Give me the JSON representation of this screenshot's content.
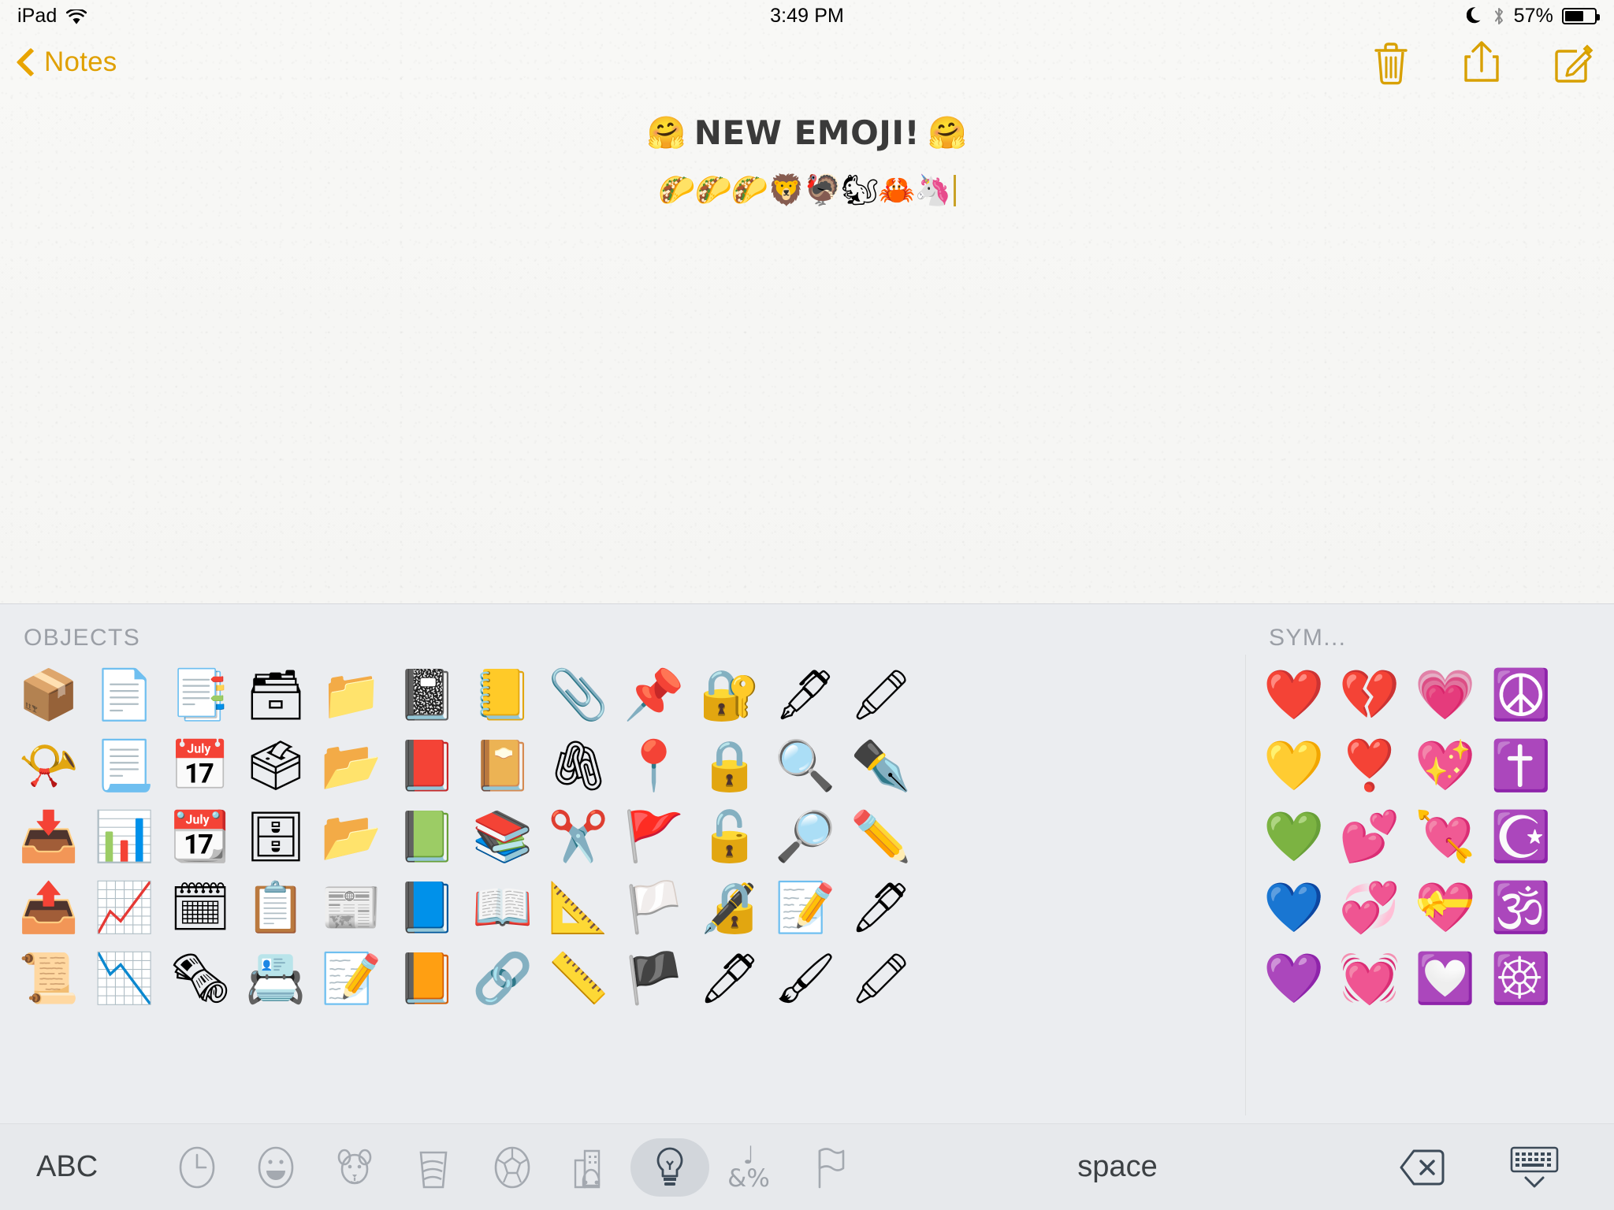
{
  "status_bar": {
    "device": "iPad",
    "wifi_icon": "wifi-icon",
    "time": "3:49 PM",
    "dnd_icon": "moon-icon",
    "bluetooth_icon": "bluetooth-icon",
    "battery_percent": "57%",
    "battery_level": 57
  },
  "nav_bar": {
    "back_label": "Notes",
    "back_icon": "chevron-left-icon",
    "accent_color": "#e0a000",
    "actions": [
      {
        "name": "trash-icon",
        "label": "Delete"
      },
      {
        "name": "share-icon",
        "label": "Share"
      },
      {
        "name": "compose-icon",
        "label": "New Note"
      }
    ]
  },
  "note": {
    "title_prefix_emoji": "🤗",
    "title_text": "NEW EMOJI!",
    "title_suffix_emoji": "🤗",
    "emoji_line": "🌮🌮🌮🦁🦃🐿🦀🦄",
    "text_color": "#3a3a3a",
    "paper_color": "#f7f7f5"
  },
  "keyboard": {
    "background": "#ebedf0",
    "sections": [
      {
        "id": "objects",
        "title": "OBJECTS",
        "emojis": [
          "📦",
          "📯",
          "📥",
          "📤",
          "📜",
          "📄",
          "📃",
          "📊",
          "📈",
          "📉",
          "📑",
          "📅",
          "📆",
          "🗓",
          "🗞",
          "🗃",
          "🗳",
          "🗄",
          "📋",
          "📇",
          "📁",
          "📂",
          "📂",
          "📰",
          "📝",
          "📓",
          "📕",
          "📗",
          "📘",
          "📙",
          "📒",
          "📔",
          "📚",
          "📖",
          "🔗",
          "📎",
          "🖇",
          "✂️",
          "📐",
          "📏",
          "📌",
          "📍",
          "🚩",
          "🏳️",
          "🏴",
          "🔐",
          "🔒",
          "🔓",
          "🔏",
          "🖊",
          "🖋",
          "🔍",
          "🔎",
          "📝",
          "🖌",
          "🖍",
          "✒️",
          "✏️",
          "🖊",
          "🖍"
        ]
      },
      {
        "id": "symbols",
        "title": "SYM...",
        "emojis": [
          "❤️",
          "💛",
          "💚",
          "💙",
          "💜",
          "💔",
          "❣️",
          "💕",
          "💞",
          "💓",
          "💗",
          "💖",
          "💘",
          "💝",
          "💟",
          "☮️",
          "✝️",
          "☪️",
          "🕉️",
          "☸️"
        ]
      }
    ],
    "bottom_bar": {
      "abc_label": "ABC",
      "space_label": "space",
      "categories": [
        {
          "name": "category-recent",
          "icon": "clock-icon",
          "active": false
        },
        {
          "name": "category-smileys",
          "icon": "smiley-icon",
          "active": false
        },
        {
          "name": "category-animals",
          "icon": "animal-icon",
          "active": false
        },
        {
          "name": "category-food",
          "icon": "food-icon",
          "active": false
        },
        {
          "name": "category-activities",
          "icon": "soccer-icon",
          "active": false
        },
        {
          "name": "category-travel",
          "icon": "buildings-icon",
          "active": false
        },
        {
          "name": "category-objects",
          "icon": "bulb-icon",
          "active": true
        },
        {
          "name": "category-symbols",
          "icon": "symbols-glyph",
          "active": false,
          "glyph_top": "♩",
          "glyph_bottom": "&%"
        },
        {
          "name": "category-flags",
          "icon": "flag-icon",
          "active": false
        }
      ],
      "delete_icon": "delete-backspace-icon",
      "dismiss_icon": "hide-keyboard-icon"
    }
  }
}
